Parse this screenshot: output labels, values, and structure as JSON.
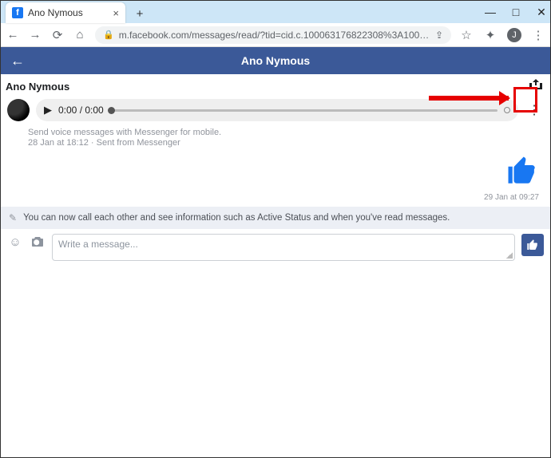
{
  "browser": {
    "tab_title": "Ano Nymous",
    "url": "m.facebook.com/messages/read/?tid=cid.c.100063176822308%3A100076924418795&entrypoint=jewel&surface_hie…",
    "profile_initial": "J"
  },
  "header": {
    "title": "Ano Nymous"
  },
  "conversation": {
    "participant_name": "Ano Nymous",
    "audio": {
      "time": "0:00 / 0:00"
    },
    "hint_text": "Send voice messages with Messenger for mobile.",
    "timestamp_line": "28 Jan at 18:12 · Sent from Messenger",
    "like_timestamp": "29 Jan at 09:27",
    "notice_text": "You can now call each other and see information such as Active Status and when you've read messages.",
    "composer_placeholder": "Write a message..."
  }
}
